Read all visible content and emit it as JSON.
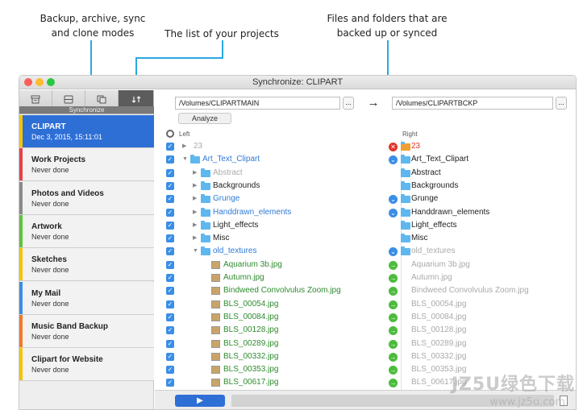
{
  "annotations": {
    "modes": "Backup, archive, sync and clone modes",
    "projects": "The list of your projects",
    "files": "Files and folders that are backed up or synced"
  },
  "window": {
    "title": "Synchronize: CLIPART"
  },
  "modebar": {
    "label": "Synchronize",
    "icons": [
      "archive-icon",
      "backup-icon",
      "clone-icon",
      "sync-icon"
    ]
  },
  "projects": [
    {
      "name": "CLIPART",
      "date": "Dec 3, 2015, 15:11:01",
      "color": "#f5c400",
      "selected": true
    },
    {
      "name": "Work Projects",
      "date": "Never done",
      "color": "#e8404a"
    },
    {
      "name": "Photos and Videos",
      "date": "Never done",
      "color": "#8a8a8a"
    },
    {
      "name": "Artwork",
      "date": "Never done",
      "color": "#5cc43a"
    },
    {
      "name": "Sketches",
      "date": "Never done",
      "color": "#f5c400"
    },
    {
      "name": "My Mail",
      "date": "Never done",
      "color": "#3d8de6"
    },
    {
      "name": "Music Band Backup",
      "date": "Never done",
      "color": "#f07a2a"
    },
    {
      "name": "Clipart for Website",
      "date": "Never done",
      "color": "#f5c400"
    }
  ],
  "paths": {
    "left": "/Volumes/CLIPARTMAIN",
    "right": "/Volumes/CLIPARTBCKP",
    "browse": "...",
    "analyze": "Analyze",
    "direction": "→"
  },
  "columns": {
    "left": "Left",
    "right": "Right"
  },
  "rows": [
    {
      "left": "23",
      "right": "23",
      "indent": 0,
      "kind": "count",
      "status": "x",
      "lcolor": "#aaaaaa",
      "rcolor": "#e0342a"
    },
    {
      "left": "Art_Text_Clipart",
      "right": "Art_Text_Clipart",
      "indent": 0,
      "kind": "folder",
      "open": true,
      "status": "down",
      "lcolor": "#2e7ad6",
      "rcolor": "#222222"
    },
    {
      "left": "Abstract",
      "right": "Abstract",
      "indent": 1,
      "kind": "folder",
      "status": "",
      "lcolor": "#aaaaaa",
      "rcolor": "#222222"
    },
    {
      "left": "Backgrounds",
      "right": "Backgrounds",
      "indent": 1,
      "kind": "folder",
      "status": "",
      "lcolor": "#222222",
      "rcolor": "#222222"
    },
    {
      "left": "Grunge",
      "right": "Grunge",
      "indent": 1,
      "kind": "folder",
      "status": "down",
      "lcolor": "#2e7ad6",
      "rcolor": "#222222"
    },
    {
      "left": "Handdrawn_elements",
      "right": "Handdrawn_elements",
      "indent": 1,
      "kind": "folder",
      "status": "down",
      "lcolor": "#2e7ad6",
      "rcolor": "#222222"
    },
    {
      "left": "Light_effects",
      "right": "Light_effects",
      "indent": 1,
      "kind": "folder",
      "status": "",
      "lcolor": "#222222",
      "rcolor": "#222222"
    },
    {
      "left": "Misc",
      "right": "Misc",
      "indent": 1,
      "kind": "folder",
      "status": "",
      "lcolor": "#222222",
      "rcolor": "#222222"
    },
    {
      "left": "old_textures",
      "right": "old_textures",
      "indent": 1,
      "kind": "folder",
      "open": true,
      "status": "down",
      "lcolor": "#2e7ad6",
      "rcolor": "#aaaaaa"
    },
    {
      "left": "Aquarium 3b.jpg",
      "right": "Aquarium 3b.jpg",
      "indent": 2,
      "kind": "file",
      "status": "right",
      "lcolor": "#2e8a2e",
      "rcolor": "#aaaaaa"
    },
    {
      "left": "Autumn.jpg",
      "right": "Autumn.jpg",
      "indent": 2,
      "kind": "file",
      "status": "right",
      "lcolor": "#2e8a2e",
      "rcolor": "#aaaaaa"
    },
    {
      "left": "Bindweed Convolvulus Zoom.jpg",
      "right": "Bindweed Convolvulus Zoom.jpg",
      "indent": 2,
      "kind": "file",
      "status": "right",
      "lcolor": "#2e8a2e",
      "rcolor": "#aaaaaa"
    },
    {
      "left": "BLS_00054.jpg",
      "right": "BLS_00054.jpg",
      "indent": 2,
      "kind": "file",
      "status": "right",
      "lcolor": "#2e8a2e",
      "rcolor": "#aaaaaa"
    },
    {
      "left": "BLS_00084.jpg",
      "right": "BLS_00084.jpg",
      "indent": 2,
      "kind": "file",
      "status": "right",
      "lcolor": "#2e8a2e",
      "rcolor": "#aaaaaa"
    },
    {
      "left": "BLS_00128.jpg",
      "right": "BLS_00128.jpg",
      "indent": 2,
      "kind": "file",
      "status": "right",
      "lcolor": "#2e8a2e",
      "rcolor": "#aaaaaa"
    },
    {
      "left": "BLS_00289.jpg",
      "right": "BLS_00289.jpg",
      "indent": 2,
      "kind": "file",
      "status": "right",
      "lcolor": "#2e8a2e",
      "rcolor": "#aaaaaa"
    },
    {
      "left": "BLS_00332.jpg",
      "right": "BLS_00332.jpg",
      "indent": 2,
      "kind": "file",
      "status": "right",
      "lcolor": "#2e8a2e",
      "rcolor": "#aaaaaa"
    },
    {
      "left": "BLS_00353.jpg",
      "right": "BLS_00353.jpg",
      "indent": 2,
      "kind": "file",
      "status": "right",
      "lcolor": "#2e8a2e",
      "rcolor": "#aaaaaa"
    },
    {
      "left": "BLS_00617.jpg",
      "right": "BLS_00617.jpg",
      "indent": 2,
      "kind": "file",
      "status": "right",
      "lcolor": "#2e8a2e",
      "rcolor": "#aaaaaa"
    }
  ],
  "bottom": {
    "play": "▶"
  },
  "watermark": {
    "main": "JZ5U绿色下载",
    "url": "www.jz5u.com"
  }
}
